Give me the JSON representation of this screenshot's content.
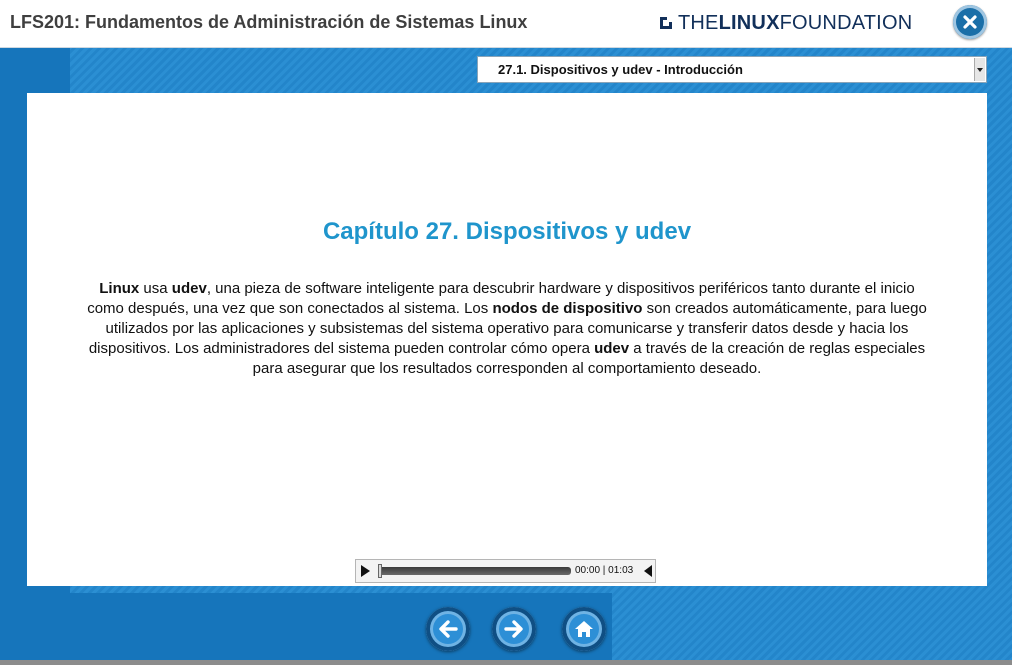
{
  "header": {
    "title": "LFS201: Fundamentos de Administración de Sistemas Linux",
    "brand_the": "THE",
    "brand_linux": "LINUX",
    "brand_foundation": "FOUNDATION",
    "close_icon": "close-icon"
  },
  "topic_select": {
    "selected": "27.1. Dispositivos y udev - Introducción"
  },
  "content": {
    "chapter_title": "Capítulo 27. Dispositivos y udev",
    "body": {
      "p1": "Linux",
      "p2": " usa ",
      "p3": "udev",
      "p4": ", una pieza de software inteligente para descubrir hardware y dispositivos periféricos tanto durante el inicio como después, una vez que son conectados al sistema. Los ",
      "p5": "nodos de dispositivo",
      "p6": " son creados automáticamente, para luego utilizados por las aplicaciones y subsistemas del sistema operativo para comunicarse y transferir datos desde y hacia los dispositivos. Los administradores del sistema pueden controlar cómo opera ",
      "p7": "udev",
      "p8": " a través de la creación de reglas especiales para asegurar que los resultados corresponden al comportamiento deseado."
    }
  },
  "player": {
    "time": "00:00 | 01:03",
    "progress": 0
  },
  "nav": {
    "back_icon": "arrow-left-icon",
    "forward_icon": "arrow-right-icon",
    "home_icon": "home-icon"
  },
  "colors": {
    "accent": "#1f95cc",
    "band": "#2385ca",
    "brand": "#12305a"
  }
}
